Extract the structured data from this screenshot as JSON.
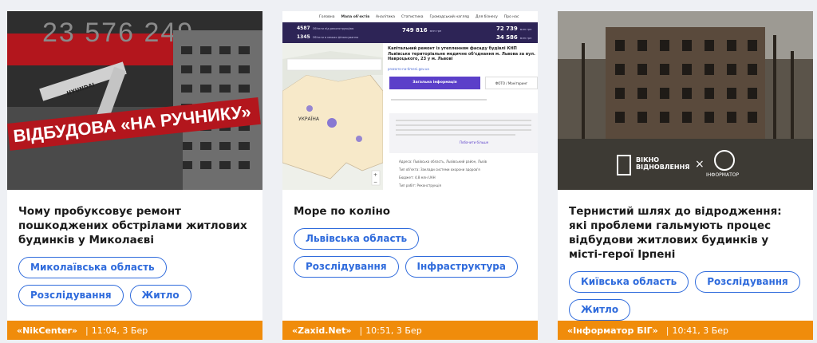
{
  "cards": [
    {
      "thumb": {
        "overlay_number": "23 576 249",
        "banner_text": "ВІДБУДОВА «НА РУЧНИКУ»",
        "excavator_brand": "HYUNDAI"
      },
      "title": "Чому пробуксовує ремонт пошкоджених обстрілами житлових будинків у Миколаєві",
      "tags": [
        "Миколаївська область",
        "Розслідування",
        "Житло"
      ],
      "source": "«NikCenter»",
      "separator": "|",
      "datetime": "11:04, 3 Бер"
    },
    {
      "thumb": {
        "nav": [
          "Головна",
          "Мапа об'єктів",
          "Аналітика",
          "Статистика",
          "Громадський нагляд",
          "Для бізнесу",
          "Про нас"
        ],
        "stats": [
          {
            "value": "4587",
            "label": "Об'єкти під реконструкцією"
          },
          {
            "value": "1345",
            "label": "Об'єкти в межах фінансування"
          },
          {
            "value": "749 816",
            "label": "млн грн"
          },
          {
            "value": "72 739",
            "label": "млн грн"
          },
          {
            "value": "34 586",
            "label": "млн грн"
          }
        ],
        "panel_title": "Капітальний ремонт із утепленням фасаду будівлі КНП Львівське територіальне медичне об'єднання м. Львова за вул. Навроцького, 23 у м. Львові",
        "panel_link": "prozorro-na-timeni.gov.ua",
        "button_main": "Загальна інформація",
        "button_secondary": "ФОТО / Моніторинг",
        "more_link": "Побачити більше",
        "map_label": "УКРАЇНА",
        "info": [
          "Адреса: Львівська область, Львівський район, Львів",
          "Тип об'єкта: Заклади системи охорони здоров'я",
          "Бюджет: 4,8 млн UAH",
          "Тип робіт: Реконструкція"
        ]
      },
      "title": "Море по коліно",
      "tags": [
        "Львівська область",
        "Розслідування",
        "Інфраструктура"
      ],
      "source": "«Zaxid.Net»",
      "separator": "|",
      "datetime": "10:51, 3 Бер"
    },
    {
      "thumb": {
        "logo1_text": "ВІКНО ВІДНОВЛЕННЯ",
        "times": "×",
        "logo2_text": "ІНФОРМАТОР"
      },
      "title": "Тернистий шлях до відродження: які проблеми гальмують процес відбудови житлових будинків у місті-герої Ірпені",
      "tags": [
        "Київська область",
        "Розслідування",
        "Житло"
      ],
      "source": "«Інформатор БІГ»",
      "separator": "|",
      "datetime": "10:41, 3 Бер"
    }
  ],
  "colors": {
    "page_bg": "#eef0f4",
    "tag_accent": "#2f6bdc",
    "footer_bg": "#f08c0b",
    "banner_red": "#b3161d",
    "site_header_purple": "#2d2456"
  }
}
